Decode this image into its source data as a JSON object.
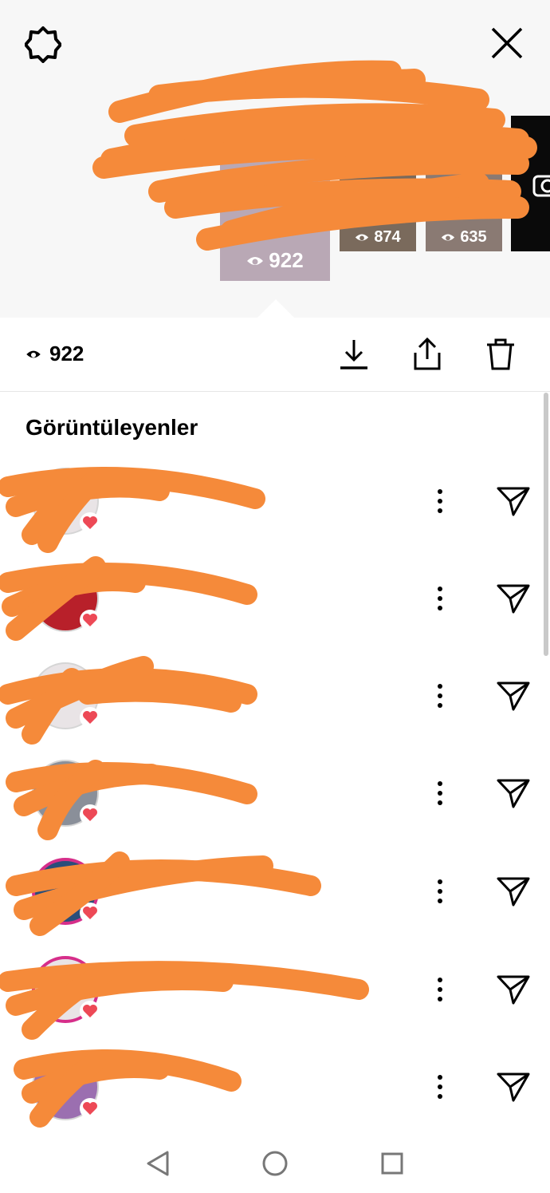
{
  "header": {
    "settings_icon": "gear-icon",
    "close_icon": "close-icon"
  },
  "stories": [
    {
      "views": "922",
      "active": true
    },
    {
      "views": "874",
      "active": false
    },
    {
      "views": "635",
      "active": false
    }
  ],
  "selected_story": {
    "views": "922",
    "actions": [
      "download-icon",
      "share-icon",
      "trash-icon"
    ]
  },
  "viewers_title": "Görüntüleyenler",
  "viewers": [
    {
      "name": "",
      "liked": true
    },
    {
      "name": "",
      "liked": true
    },
    {
      "name": "",
      "liked": true
    },
    {
      "name": "",
      "liked": true
    },
    {
      "name": "",
      "liked": true
    },
    {
      "name": "",
      "liked": true
    },
    {
      "name": "",
      "liked": true
    }
  ],
  "colors": {
    "redaction": "#f58a3a",
    "heart": "#ed4956",
    "story_ring": "#d62e8a"
  },
  "nav": [
    "back-icon",
    "home-icon",
    "recents-icon"
  ]
}
